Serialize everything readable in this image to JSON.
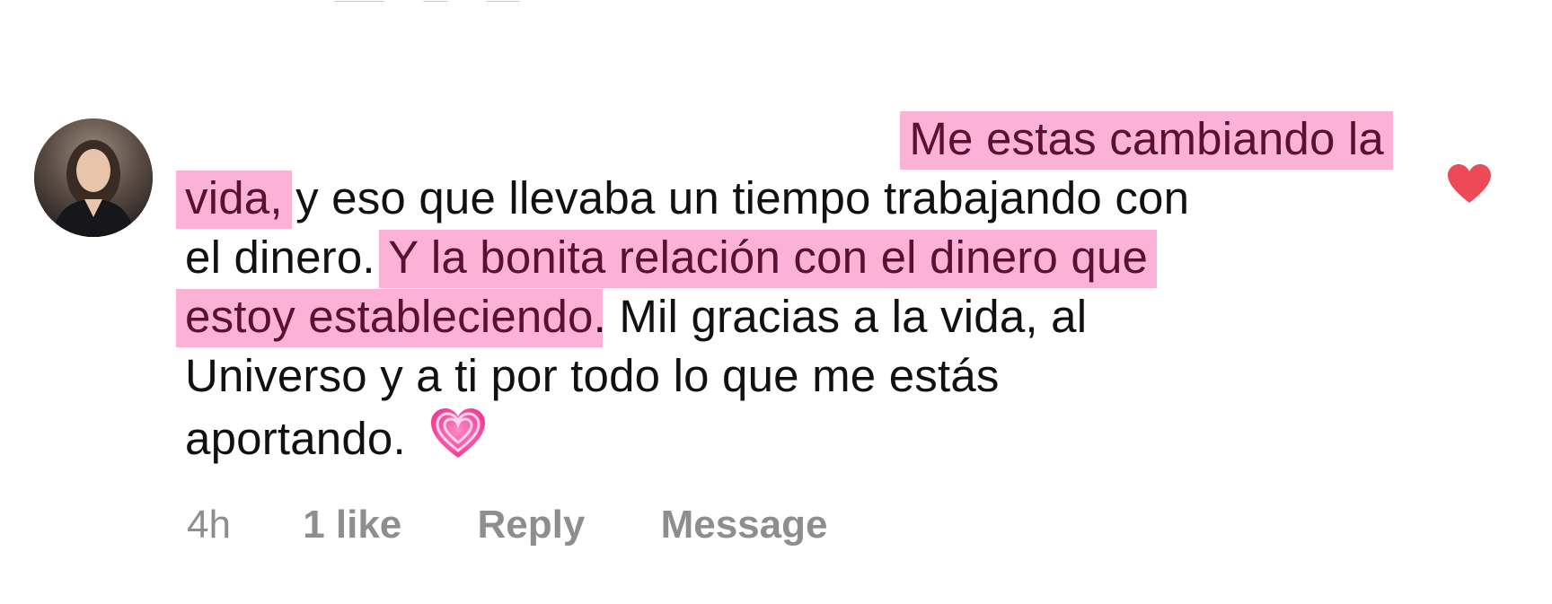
{
  "comment": {
    "text_lines": [
      {
        "pre": "",
        "highlight": "Me estas cambiando la",
        "post": ""
      },
      {
        "pre": "",
        "highlight": "vida,",
        "post": " y eso que llevaba un tiempo trabajando con"
      },
      {
        "pre": "el dinero. ",
        "highlight": "Y la bonita relación con el dinero que",
        "post": ""
      },
      {
        "pre": "",
        "highlight": "estoy estableciendo",
        "post": ". Mil gracias a la vida, al"
      },
      {
        "pre": "Universo y a ti por todo lo que me estás",
        "highlight": "",
        "post": ""
      },
      {
        "pre": "aportando.",
        "highlight": "",
        "post": ""
      }
    ],
    "emoji": "growing-heart-emoji",
    "liked": true
  },
  "actions": {
    "time": "4h",
    "likes": "1 like",
    "reply": "Reply",
    "message": "Message"
  },
  "colors": {
    "highlight": "#fcb1d6",
    "heart": "#ed4956",
    "action_text": "#8e8e8e"
  }
}
